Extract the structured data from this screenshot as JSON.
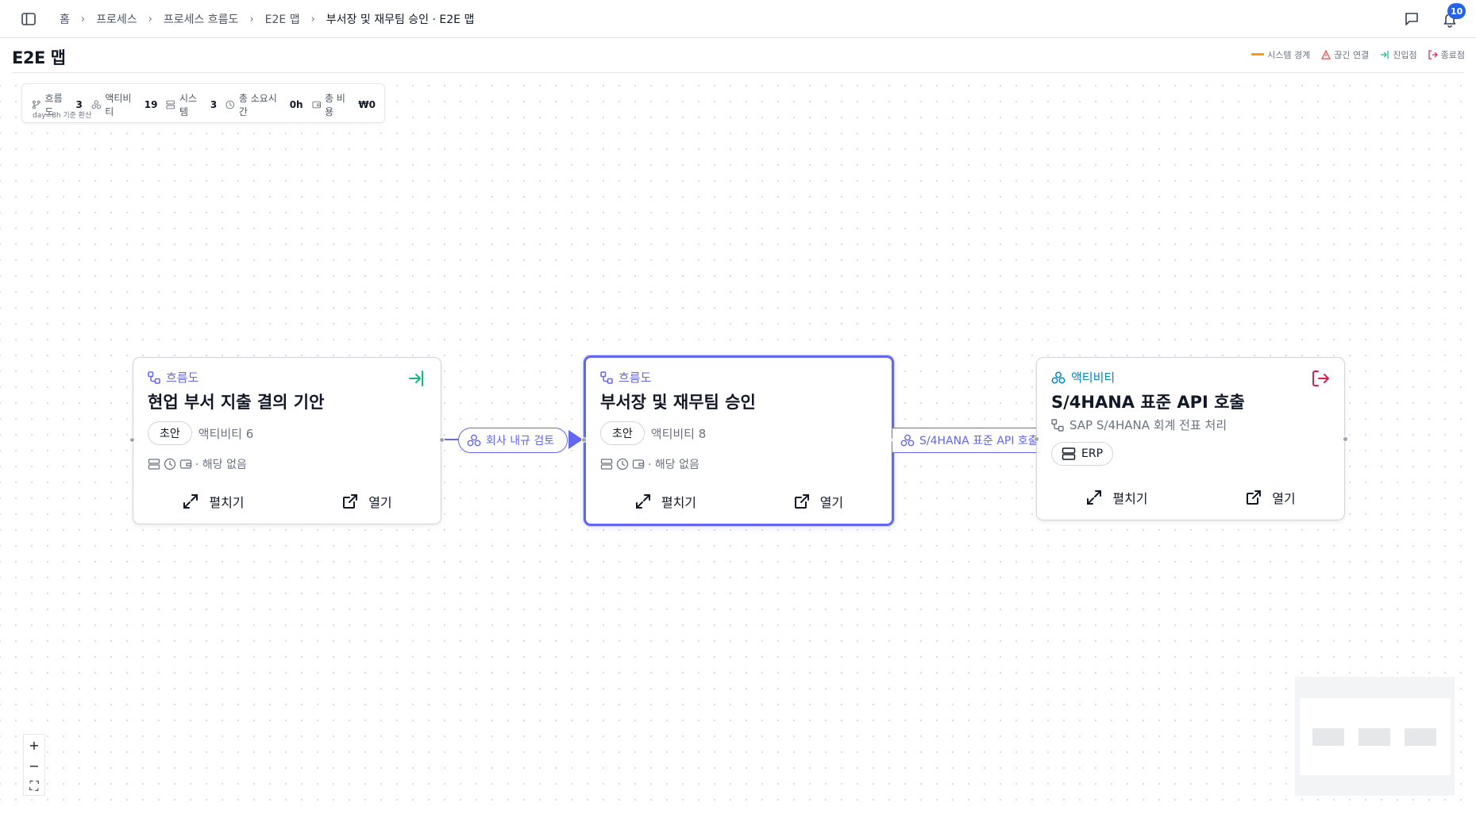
{
  "breadcrumb": [
    "홈",
    "프로세스",
    "프로세스 흐름도",
    "E2E 맵",
    "부서장 및 재무팀 승인 · E2E 맵"
  ],
  "notifications": {
    "count": "10"
  },
  "page": {
    "title": "E2E 맵"
  },
  "legend": [
    {
      "label": "시스템 경계",
      "color": "#f59e0b",
      "icon": "line"
    },
    {
      "label": "끊긴 연결",
      "color": "#ef4444",
      "icon": "warning-icon"
    },
    {
      "label": "진입점",
      "color": "#10b981",
      "icon": "entry-icon"
    },
    {
      "label": "종료점",
      "color": "#e11d48",
      "icon": "exit-icon"
    }
  ],
  "stats": {
    "flows_label": "흐름도",
    "flows_value": "3",
    "activities_label": "액티비티",
    "activities_value": "19",
    "systems_label": "시스템",
    "systems_value": "3",
    "time_label": "총 소요시간",
    "time_value": "0h",
    "cost_label": "총 비용",
    "cost_value": "₩0",
    "note": "day=8h 기준 환산"
  },
  "nodes": [
    {
      "kind": "흐름도",
      "title": "현업 부서 지출 결의 기안",
      "status": "초안",
      "count": "액티비티 6",
      "meta": "· 해당 없음",
      "expand": "펼치기",
      "open": "열기"
    },
    {
      "kind": "흐름도",
      "title": "부서장 및 재무팀 승인",
      "status": "초안",
      "count": "액티비티 8",
      "meta": "· 해당 없음",
      "expand": "펼치기",
      "open": "열기"
    },
    {
      "kind": "액티비티",
      "title": "S/4HANA 표준 API 호출",
      "subtitle": "SAP S/4HANA 회계 전표 처리",
      "system": "ERP",
      "expand": "펼치기",
      "open": "열기"
    }
  ],
  "edges": [
    {
      "label": "회사 내규 검토"
    },
    {
      "label": "S/4HANA 표준 API 호출"
    }
  ],
  "zoom": {
    "in": "+",
    "out": "−",
    "fit": "⛶"
  },
  "colors": {
    "accent": "#6366f1",
    "activity": "#0284c7",
    "entry": "#10b981",
    "exit": "#e11d48"
  }
}
